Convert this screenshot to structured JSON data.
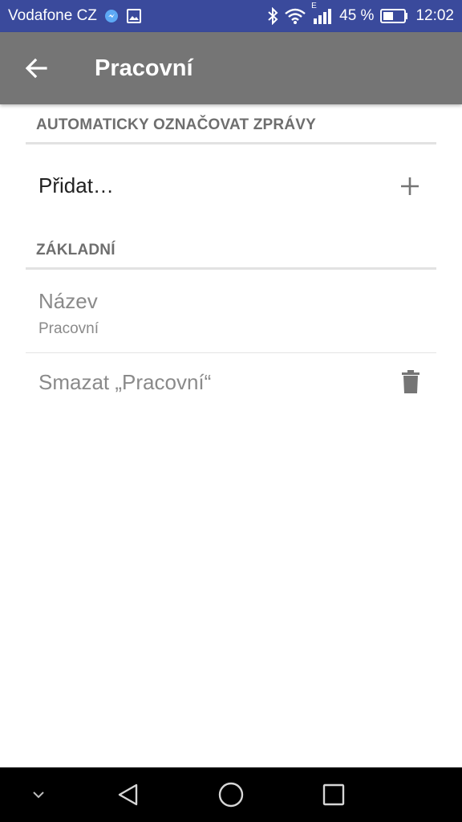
{
  "status_bar": {
    "carrier": "Vodafone CZ",
    "network_type": "E",
    "battery_percent": "45 %",
    "time": "12:02"
  },
  "app_bar": {
    "title": "Pracovní"
  },
  "sections": {
    "auto_label": {
      "header": "AUTOMATICKY OZNAČOVAT ZPRÁVY",
      "add_label": "Přidat…"
    },
    "basic": {
      "header": "ZÁKLADNÍ",
      "name_title": "Název",
      "name_value": "Pracovní",
      "delete_label": "Smazat „Pracovní“"
    }
  },
  "colors": {
    "status_bar": "#3a4a9c",
    "app_bar": "#757575",
    "nav_bar": "#000000"
  }
}
